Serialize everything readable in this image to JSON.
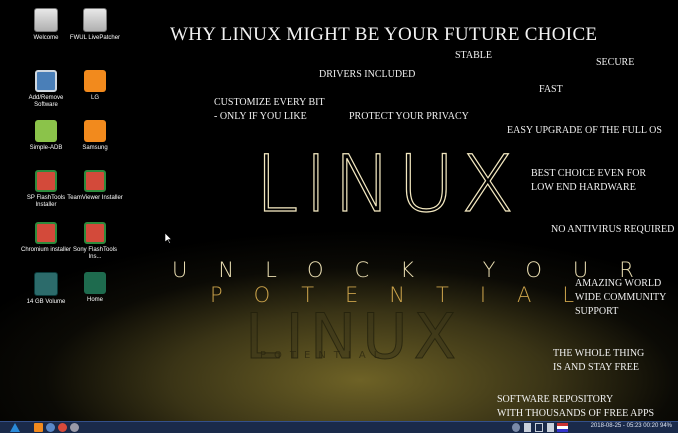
{
  "wallpaper": {
    "title": "WHY LINUX MIGHT BE YOUR FUTURE CHOICE",
    "big_text": "LINUX",
    "tagline_1": "UNLOCK YOUR",
    "tagline_2": "POTENTIAL",
    "features": {
      "drivers": "DRIVERS INCLUDED",
      "stable": "STABLE",
      "secure": "SECURE",
      "fast": "FAST",
      "customize_1": "CUSTOMIZE EVERY BIT",
      "customize_2": "- ONLY IF YOU LIKE",
      "privacy": "PROTECT YOUR PRIVACY",
      "upgrade": "EASY UPGRADE OF THE FULL OS",
      "lowend_1": "BEST CHOICE EVEN FOR",
      "lowend_2": "LOW END HARDWARE",
      "antivirus": "NO ANTIVIRUS REQUIRED",
      "community_1": "AMAZING WORLD",
      "community_2": "WIDE COMMUNITY",
      "community_3": "SUPPORT",
      "free_1": "THE WHOLE THING",
      "free_2": "IS AND STAY FREE",
      "repo_1": "SOFTWARE REPOSITORY",
      "repo_2": "WITH THOUSANDS OF FREE APPS"
    }
  },
  "desktop_icons": [
    {
      "label": "Welcome",
      "icon": "fwul-icon"
    },
    {
      "label": "FWUL LivePatcher",
      "icon": "fwul-icon"
    },
    {
      "label": "Add/Remove Software",
      "icon": "package-icon"
    },
    {
      "label": "LG",
      "icon": "folder-icon"
    },
    {
      "label": "Simple-ADB",
      "icon": "android-icon"
    },
    {
      "label": "Samsung",
      "icon": "folder-icon"
    },
    {
      "label": "SP FlashTools Installer",
      "icon": "installer-icon"
    },
    {
      "label": "TeamViewer Installer",
      "icon": "installer-icon"
    },
    {
      "label": "Chromium installer",
      "icon": "installer-icon"
    },
    {
      "label": "Sony FlashTools Ins...",
      "icon": "installer-icon"
    },
    {
      "label": "14 GB Volume",
      "icon": "drive-icon"
    },
    {
      "label": "Home",
      "icon": "home-folder-icon"
    }
  ],
  "taskbar": {
    "clock": "2018-08-25 - 05:23",
    "battery": "00:20  94%"
  }
}
